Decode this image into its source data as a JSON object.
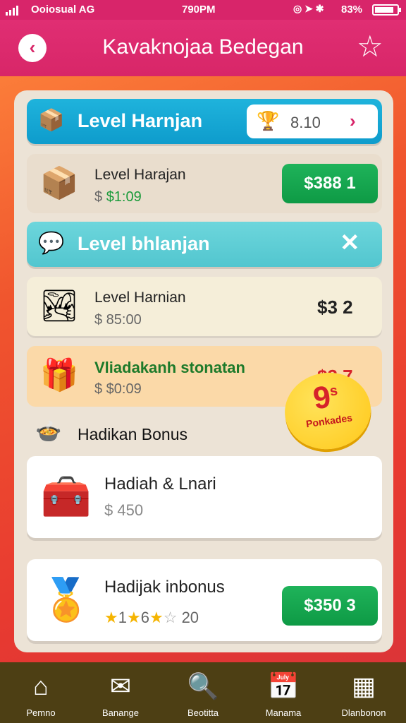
{
  "status": {
    "carrier": "Ooiosual AG",
    "time": "790PM",
    "battery": "83%"
  },
  "header": {
    "title": "Kavaknojaa Bedegan",
    "back_icon": "arrow-left-icon",
    "star_icon": "star-icon"
  },
  "sections": {
    "band1": {
      "label": "Level Harnjan",
      "pill_value": "8.10"
    },
    "band2": {
      "label": "Level bhlanjan"
    }
  },
  "items": [
    {
      "name": "Level Harajan",
      "sub_prefix": "$",
      "sub_value": "$1:09",
      "action": "$388 1"
    },
    {
      "name": "Level Harnian",
      "sub": "$ 85:00",
      "price": "$3 2"
    },
    {
      "name": "Vliadakanh stonatan",
      "sub": "$ $0:09",
      "price": "$3 7"
    }
  ],
  "bonus": {
    "title": "Hadikan Bonus",
    "card1": {
      "name": "Hadiah & Lnari",
      "sub": "$ 450"
    },
    "badge": {
      "number": "9",
      "sup": "s",
      "label": "Ponkades"
    },
    "card2": {
      "name": "Hadijak inbonus",
      "stars": "★1★6★☆ 20",
      "rating_1": "1",
      "rating_2": "6",
      "rating_3": "20",
      "action": "$350 3"
    }
  },
  "nav": [
    {
      "label": "Pemno",
      "icon": "home-icon"
    },
    {
      "label": "Banange",
      "icon": "mail-icon"
    },
    {
      "label": "Beotitta",
      "icon": "search-icon"
    },
    {
      "label": "Manama",
      "icon": "calendar-icon"
    },
    {
      "label": "Dlanbonon",
      "icon": "grid-icon"
    }
  ],
  "colors": {
    "accent": "#d8256a",
    "green": "#1fb35a",
    "cyan": "#1fb3dc",
    "nav_bg": "#4d3f14"
  }
}
